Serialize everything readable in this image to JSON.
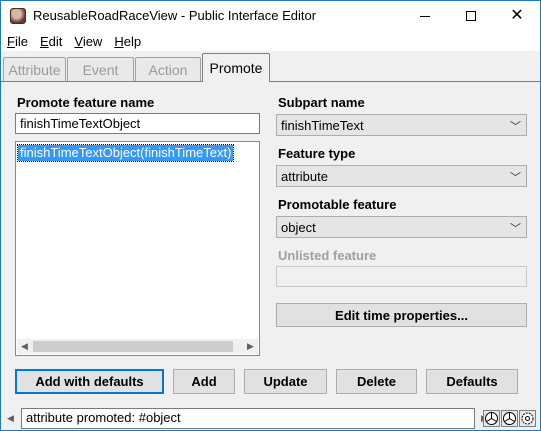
{
  "window": {
    "title": "ReusableRoadRaceView - Public Interface Editor",
    "icon": "app-icon"
  },
  "menu": [
    {
      "label": "File",
      "mnemonic": "F",
      "rest": "ile"
    },
    {
      "label": "Edit",
      "mnemonic": "E",
      "rest": "dit"
    },
    {
      "label": "View",
      "mnemonic": "V",
      "rest": "iew"
    },
    {
      "label": "Help",
      "mnemonic": "H",
      "rest": "elp"
    }
  ],
  "tabs": [
    {
      "label": "Attribute",
      "active": false
    },
    {
      "label": "Event",
      "active": false
    },
    {
      "label": "Action",
      "active": false
    },
    {
      "label": "Promote",
      "active": true
    }
  ],
  "promote": {
    "feature_name_label": "Promote feature name",
    "feature_name_value": "finishTimeTextObject",
    "list_items": [
      "finishTimeTextObject(finishTimeText)"
    ],
    "subpart_label": "Subpart name",
    "subpart_value": "finishTimeText",
    "feature_type_label": "Feature type",
    "feature_type_value": "attribute",
    "promotable_label": "Promotable feature",
    "promotable_value": "object",
    "unlisted_label": "Unlisted feature",
    "unlisted_value": "",
    "edit_time_button": "Edit time properties..."
  },
  "buttons": {
    "add_defaults": "Add with defaults",
    "add": "Add",
    "update": "Update",
    "delete": "Delete",
    "defaults": "Defaults"
  },
  "status": {
    "message": "attribute promoted: #object"
  },
  "colors": {
    "selection": "#3399ff",
    "window_border": "#1979ca",
    "default_button_border": "#0078d7"
  }
}
